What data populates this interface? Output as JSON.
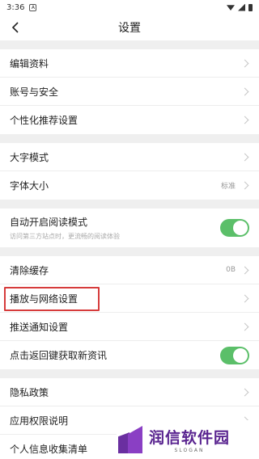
{
  "status_bar": {
    "time": "3:36",
    "notif": "A"
  },
  "nav": {
    "title": "设置"
  },
  "groups": [
    {
      "rows": [
        {
          "label": "编辑资料"
        },
        {
          "label": "账号与安全"
        },
        {
          "label": "个性化推荐设置"
        }
      ]
    },
    {
      "rows": [
        {
          "label": "大字模式"
        },
        {
          "label": "字体大小",
          "value": "标准"
        }
      ]
    },
    {
      "rows": [
        {
          "label": "自动开启阅读模式",
          "sub": "访问第三方站点时，更流畅的阅读体验",
          "toggle": true
        }
      ]
    },
    {
      "rows": [
        {
          "label": "清除缓存",
          "value": "0B"
        },
        {
          "label": "播放与网络设置",
          "highlighted": true
        },
        {
          "label": "推送通知设置"
        },
        {
          "label": "点击返回键获取新资讯",
          "toggle": true
        }
      ]
    },
    {
      "rows": [
        {
          "label": "隐私政策"
        },
        {
          "label": "应用权限说明"
        },
        {
          "label": "个人信息收集清单"
        }
      ]
    }
  ],
  "watermark": {
    "title": "润信软件园",
    "slogan": "SLOGAN"
  },
  "colors": {
    "toggle_on": "#5bbf69",
    "highlight": "#d63b3b",
    "brand": "#5a2590"
  }
}
